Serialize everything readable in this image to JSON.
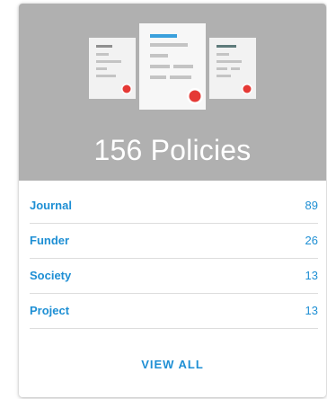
{
  "card": {
    "title": "156 Policies",
    "colors": {
      "hero_bg": "#b0b0b0",
      "accent": "#1e8fd4",
      "doc_paper": "#f2f2f2",
      "doc_line_gray": "#9a9a9a",
      "doc_line_blue": "#3aa0dc",
      "doc_line_teal": "#5e7b7b",
      "seal_red": "#e53935"
    },
    "rows": [
      {
        "label": "Journal",
        "count": "89"
      },
      {
        "label": "Funder",
        "count": "26"
      },
      {
        "label": "Society",
        "count": "13"
      },
      {
        "label": "Project",
        "count": "13"
      }
    ],
    "view_all_label": "VIEW ALL",
    "icons": {
      "left_doc": "document-with-seal-icon",
      "center_doc": "document-with-seal-icon",
      "right_doc": "document-with-seal-icon"
    }
  }
}
